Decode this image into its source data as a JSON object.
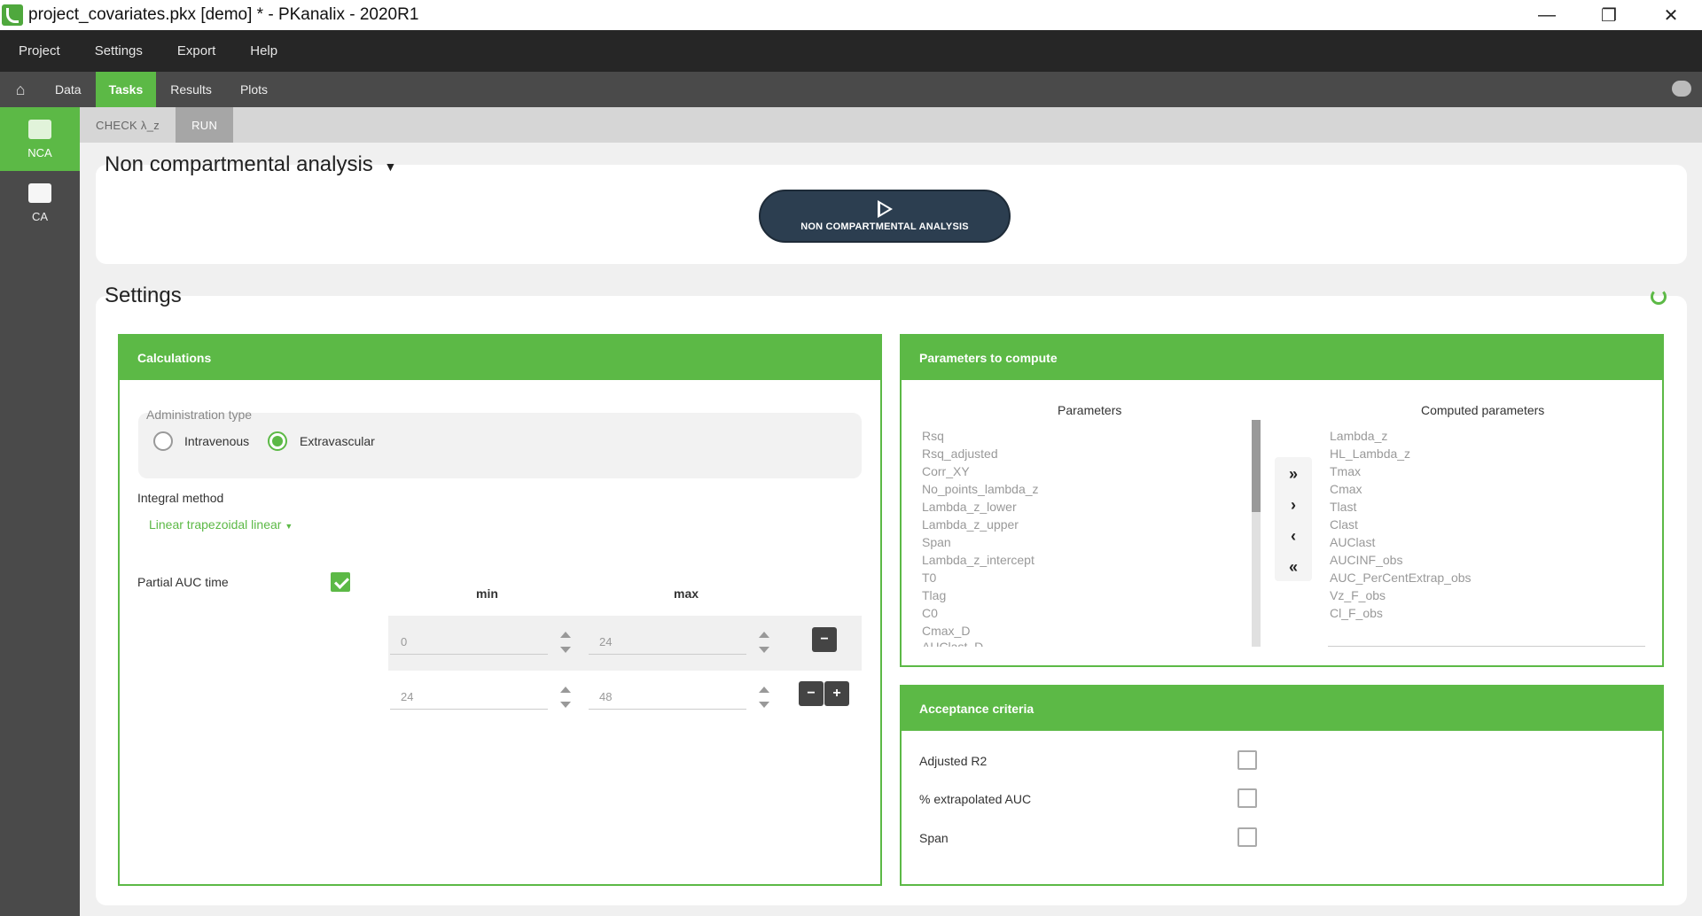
{
  "window": {
    "title": "project_covariates.pkx [demo] * - PKanalix - 2020R1",
    "controls": {
      "minimize": "—",
      "restore": "❐",
      "close": "✕"
    }
  },
  "menu": {
    "items": [
      "Project",
      "Settings",
      "Export",
      "Help"
    ]
  },
  "tabs": {
    "home_icon": "home-icon",
    "items": [
      {
        "label": "Data",
        "active": false
      },
      {
        "label": "Tasks",
        "active": true
      },
      {
        "label": "Results",
        "active": false
      },
      {
        "label": "Plots",
        "active": false
      }
    ]
  },
  "subtabs": {
    "items": [
      {
        "label": "CHECK λ_z",
        "active": false
      },
      {
        "label": "RUN",
        "active": true
      }
    ]
  },
  "sidebar": {
    "items": [
      {
        "label": "NCA",
        "active": true
      },
      {
        "label": "CA",
        "active": false
      }
    ]
  },
  "task": {
    "title": "Non compartmental analysis",
    "run_button": "NON COMPARTMENTAL ANALYSIS"
  },
  "settings": {
    "title": "Settings",
    "calculations": {
      "header": "Calculations",
      "admin_type_label": "Administration type",
      "admin_options": [
        {
          "label": "Intravenous",
          "selected": false
        },
        {
          "label": "Extravascular",
          "selected": true
        }
      ],
      "integral_method_label": "Integral method",
      "integral_method_value": "Linear trapezoidal linear",
      "partial_auc_label": "Partial AUC time",
      "partial_auc_checked": true,
      "min_header": "min",
      "max_header": "max",
      "rows": [
        {
          "min": "0",
          "max": "24"
        },
        {
          "min": "24",
          "max": "48"
        }
      ],
      "minus": "−",
      "plus": "+"
    },
    "parameters": {
      "header": "Parameters to compute",
      "available_title": "Parameters",
      "computed_title": "Computed parameters",
      "available": [
        "Rsq",
        "Rsq_adjusted",
        "Corr_XY",
        "No_points_lambda_z",
        "Lambda_z_lower",
        "Lambda_z_upper",
        "Span",
        "Lambda_z_intercept",
        "T0",
        "Tlag",
        "C0",
        "Cmax_D",
        "AUClast_D"
      ],
      "computed": [
        "Lambda_z",
        "HL_Lambda_z",
        "Tmax",
        "Cmax",
        "Tlast",
        "Clast",
        "AUClast",
        "AUCINF_obs",
        "AUC_PerCentExtrap_obs",
        "Vz_F_obs",
        "Cl_F_obs"
      ],
      "buttons": {
        "add_all": "»",
        "add": "›",
        "remove": "‹",
        "remove_all": "«"
      }
    },
    "acceptance": {
      "header": "Acceptance criteria",
      "items": [
        {
          "label": "Adjusted R2",
          "checked": false
        },
        {
          "label": "% extrapolated AUC",
          "checked": false
        },
        {
          "label": "Span",
          "checked": false
        }
      ]
    }
  },
  "colors": {
    "accent": "#5cb946",
    "dark": "#262626",
    "run_button": "#2c3e50"
  }
}
